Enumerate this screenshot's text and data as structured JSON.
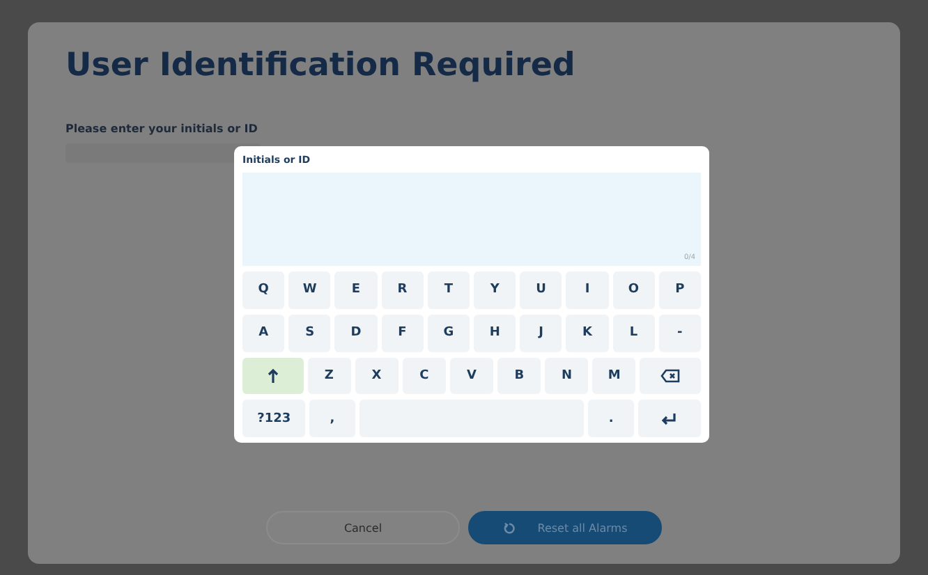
{
  "title": "User Identification Required",
  "prompt": "Please enter your initials or ID",
  "keyboard": {
    "label": "Initials or ID",
    "counter": "0/4",
    "rows": [
      [
        {
          "kind": "char",
          "label": "Q"
        },
        {
          "kind": "char",
          "label": "W"
        },
        {
          "kind": "char",
          "label": "E"
        },
        {
          "kind": "char",
          "label": "R"
        },
        {
          "kind": "char",
          "label": "T"
        },
        {
          "kind": "char",
          "label": "Y"
        },
        {
          "kind": "char",
          "label": "U"
        },
        {
          "kind": "char",
          "label": "I"
        },
        {
          "kind": "char",
          "label": "O"
        },
        {
          "kind": "char",
          "label": "P"
        }
      ],
      [
        {
          "kind": "char",
          "label": "A"
        },
        {
          "kind": "char",
          "label": "S"
        },
        {
          "kind": "char",
          "label": "D"
        },
        {
          "kind": "char",
          "label": "F"
        },
        {
          "kind": "char",
          "label": "G"
        },
        {
          "kind": "char",
          "label": "H"
        },
        {
          "kind": "char",
          "label": "J"
        },
        {
          "kind": "char",
          "label": "K"
        },
        {
          "kind": "char",
          "label": "L"
        },
        {
          "kind": "char",
          "label": "-"
        }
      ],
      [
        {
          "kind": "shift",
          "selected": true
        },
        {
          "kind": "char",
          "label": "Z"
        },
        {
          "kind": "char",
          "label": "X"
        },
        {
          "kind": "char",
          "label": "C"
        },
        {
          "kind": "char",
          "label": "V"
        },
        {
          "kind": "char",
          "label": "B"
        },
        {
          "kind": "char",
          "label": "N"
        },
        {
          "kind": "char",
          "label": "M"
        },
        {
          "kind": "backspace"
        }
      ],
      [
        {
          "kind": "mode",
          "label": "?123"
        },
        {
          "kind": "char",
          "label": ","
        },
        {
          "kind": "space"
        },
        {
          "kind": "char",
          "label": "."
        },
        {
          "kind": "enter"
        }
      ]
    ]
  },
  "buttons": [
    {
      "kind": "secondary",
      "label": "Cancel"
    },
    {
      "kind": "primary",
      "label": "Reset all Alarms"
    }
  ]
}
